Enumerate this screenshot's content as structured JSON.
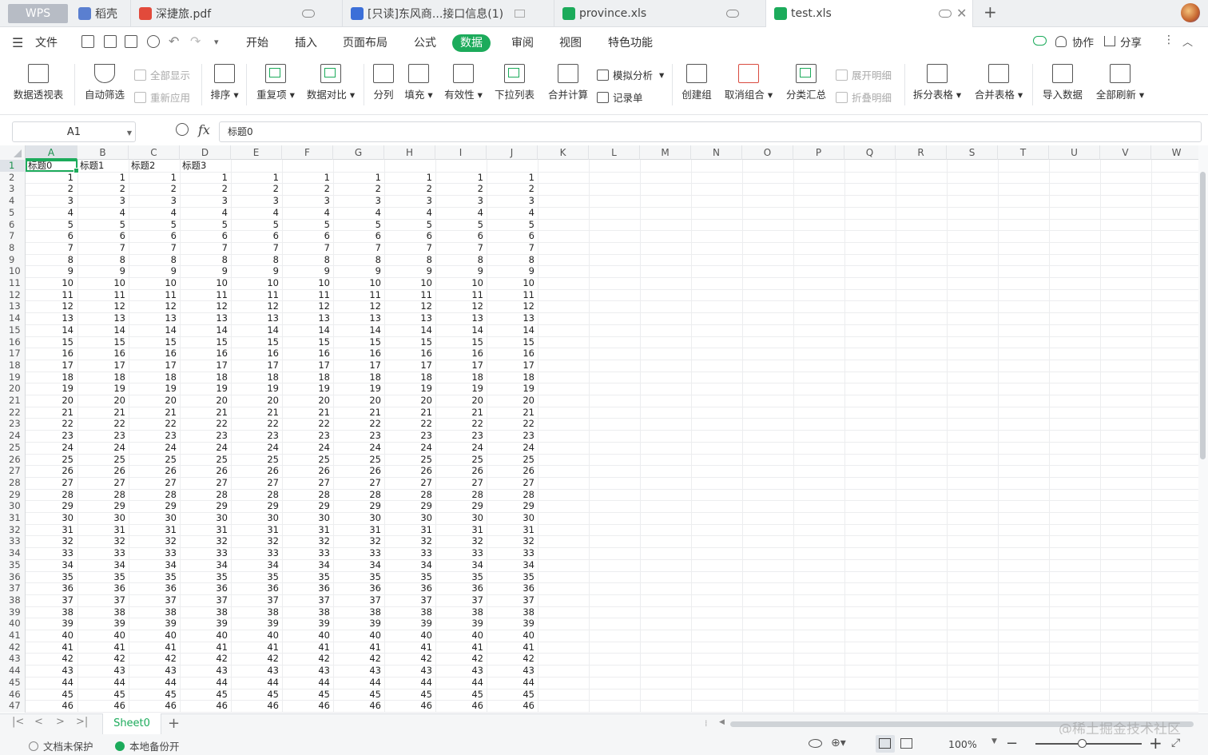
{
  "tabs": [
    {
      "label": "WPS"
    },
    {
      "label": "稻壳"
    },
    {
      "label": "深捷旅.pdf"
    },
    {
      "label": "[只读]东风商...接口信息(1)"
    },
    {
      "label": "province.xls"
    },
    {
      "label": "test.xls"
    }
  ],
  "menu": {
    "file": "文件",
    "items": [
      "开始",
      "插入",
      "页面布局",
      "公式",
      "数据",
      "审阅",
      "视图",
      "特色功能"
    ],
    "active": "数据",
    "collab": "协作",
    "share": "分享"
  },
  "ribbon": {
    "pivot": "数据透视表",
    "autofilter": "自动筛选",
    "showall": "全部显示",
    "reapply": "重新应用",
    "sort": "排序",
    "duplicates": "重复项",
    "compare": "数据对比",
    "split": "分列",
    "fill": "填充",
    "validity": "有效性",
    "dropdown": "下拉列表",
    "consolidate": "合并计算",
    "simulate": "模拟分析",
    "record": "记录单",
    "group": "创建组",
    "ungroup": "取消组合",
    "subtotal": "分类汇总",
    "expand": "展开明细",
    "collapse": "折叠明细",
    "splittable": "拆分表格",
    "mergetable": "合并表格",
    "import": "导入数据",
    "refresh": "全部刷新"
  },
  "formula": {
    "cell_ref": "A1",
    "fx": "fx",
    "content": "标题0"
  },
  "columns": [
    "A",
    "B",
    "C",
    "D",
    "E",
    "F",
    "G",
    "H",
    "I",
    "J",
    "K",
    "L",
    "M",
    "N",
    "O",
    "P",
    "Q",
    "R",
    "S",
    "T",
    "U",
    "V",
    "W"
  ],
  "headers": [
    "标题0",
    "标题1",
    "标题2",
    "标题3"
  ],
  "rows": [
    1,
    2,
    3,
    4,
    5,
    6,
    7,
    8,
    9,
    10,
    11,
    12,
    13,
    14,
    15,
    16,
    17,
    18,
    19,
    20,
    21,
    22,
    23,
    24,
    25,
    26,
    27,
    28,
    29,
    30,
    31,
    32,
    33,
    34,
    35,
    36,
    37,
    38,
    39,
    40,
    41,
    42,
    43,
    44,
    45,
    46,
    47
  ],
  "values": [
    1,
    2,
    3,
    4,
    5,
    6,
    7,
    8,
    9,
    10,
    11,
    12,
    13,
    14,
    15,
    16,
    17,
    18,
    19,
    20,
    21,
    22,
    23,
    24,
    25,
    26,
    27,
    28,
    29,
    30,
    31,
    32,
    33,
    34,
    35,
    36,
    37,
    38,
    39,
    40,
    41,
    42,
    43,
    44,
    45,
    46
  ],
  "sheet": {
    "name": "Sheet0"
  },
  "status": {
    "protect": "文档未保护",
    "backup": "本地备份开",
    "zoom": "100%"
  },
  "watermark": "@稀土掘金技术社区",
  "colors": {
    "accent": "#1cab5b"
  }
}
